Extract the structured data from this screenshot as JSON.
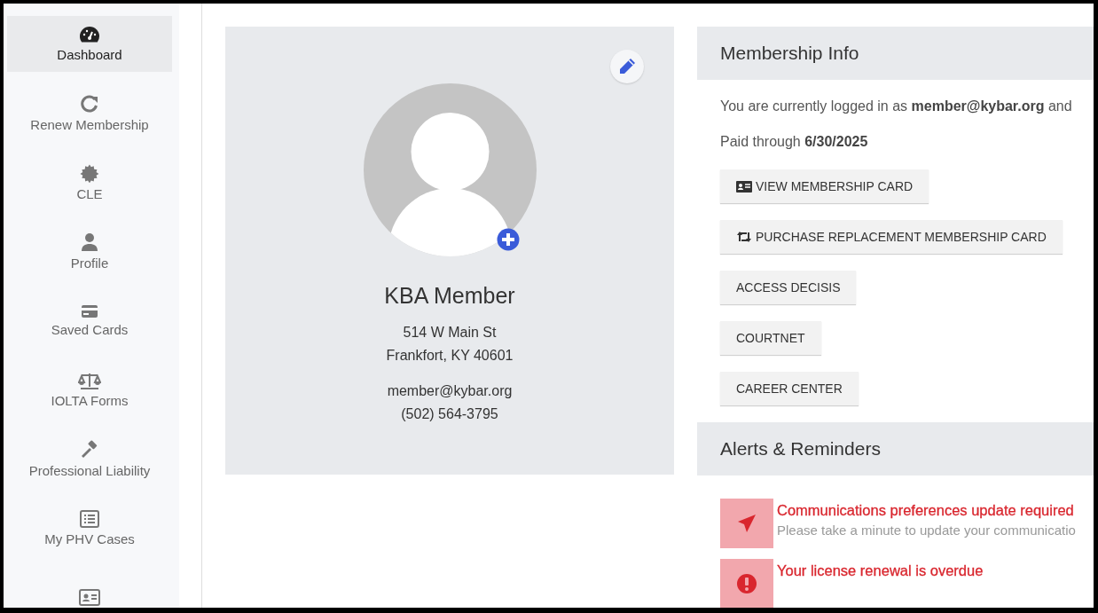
{
  "sidebar": {
    "items": [
      {
        "label": "Dashboard",
        "kind": "gauge",
        "selected": true
      },
      {
        "label": "Renew Membership",
        "kind": "renew",
        "selected": false
      },
      {
        "label": "CLE",
        "kind": "badge",
        "selected": false
      },
      {
        "label": "Profile",
        "kind": "person",
        "selected": false
      },
      {
        "label": "Saved Cards",
        "kind": "card",
        "selected": false
      },
      {
        "label": "IOLTA Forms",
        "kind": "scale",
        "selected": false
      },
      {
        "label": "Professional Liability",
        "kind": "gavel",
        "selected": false
      },
      {
        "label": "My PHV Cases",
        "kind": "list",
        "selected": false
      },
      {
        "kind": "idcard",
        "selected": false
      }
    ]
  },
  "profile": {
    "name": "KBA Member",
    "address_lines": [
      "514 W Main St",
      "Frankfort, KY 40601"
    ],
    "email": "member@kybar.org",
    "phone": "(502) 564-3795"
  },
  "membership_info": {
    "title": "Membership Info",
    "login_text": "You are currently logged in as **member@kybar.org** and",
    "paid_text": "Paid through **6/30/2025**",
    "buttons": [
      {
        "label": "VIEW MEMBERSHIP CARD",
        "kind": "card"
      },
      {
        "label": "PURCHASE REPLACEMENT MEMBERSHIP CARD",
        "kind": "swap"
      },
      {
        "label": "ACCESS DECISIS",
        "kind": "plain"
      },
      {
        "label": "COURTNET",
        "kind": "plain"
      },
      {
        "label": "CAREER CENTER",
        "kind": "plain"
      }
    ]
  },
  "alerts": {
    "title": "Alerts & Reminders",
    "items": [
      {
        "kind": "send",
        "title": "Communications preferences update required",
        "text": "Please take a minute to update your communicatio"
      },
      {
        "kind": "exclaim",
        "title": "Your license renewal is overdue"
      }
    ]
  }
}
